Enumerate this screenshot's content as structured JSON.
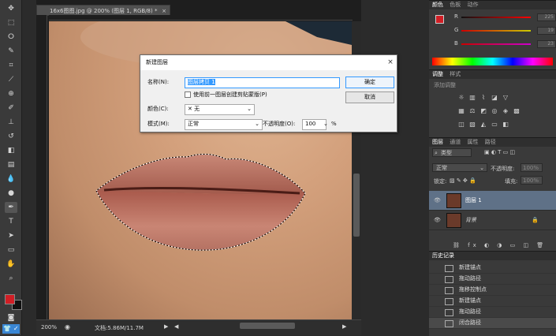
{
  "document": {
    "tab_title": "16x6图图.jpg @ 200% (图层 1, RGB/8) *",
    "zoom": "200%",
    "doc_info": "文档:5.86M/11.7M"
  },
  "color_panel": {
    "tabs": [
      "颜色",
      "色板",
      "动作"
    ],
    "r_label": "R",
    "g_label": "G",
    "b_label": "B",
    "r_value": "225",
    "g_value": "19",
    "b_value": "23",
    "foreground": "#d11e25"
  },
  "adjustments_panel": {
    "tabs": [
      "调整",
      "样式"
    ],
    "hint": "添加调整"
  },
  "layers_panel": {
    "tabs": [
      "图层",
      "通道",
      "属性",
      "路径"
    ],
    "filter": "类型",
    "blend_mode": "正常",
    "opacity_label": "不透明度:",
    "opacity": "100%",
    "lock_label": "锁定:",
    "fill_label": "填充:",
    "fill": "100%",
    "layers": [
      {
        "name": "图层 1",
        "selected": true
      },
      {
        "name": "背景",
        "selected": false
      }
    ]
  },
  "history_panel": {
    "title": "历史记录",
    "items": [
      "新建锚点",
      "拖动路径",
      "拖移控制点",
      "新建锚点",
      "拖动路径",
      "闭合路径"
    ]
  },
  "dialog": {
    "title": "新建图层",
    "name_label": "名称(N):",
    "name_value": "图层拷贝 1",
    "clip_label": "使用前一图层创建剪贴蒙版(P)",
    "color_label": "颜色(C):",
    "color_value": "无",
    "mode_label": "模式(M):",
    "mode_value": "正常",
    "opacity_label": "不透明度(O):",
    "opacity_value": "100",
    "percent": "%",
    "ok_label": "确定",
    "cancel_label": "取消"
  },
  "accent_colors": {
    "selection_blue": "#3a5a85",
    "dialog_highlight": "#3399ff"
  }
}
